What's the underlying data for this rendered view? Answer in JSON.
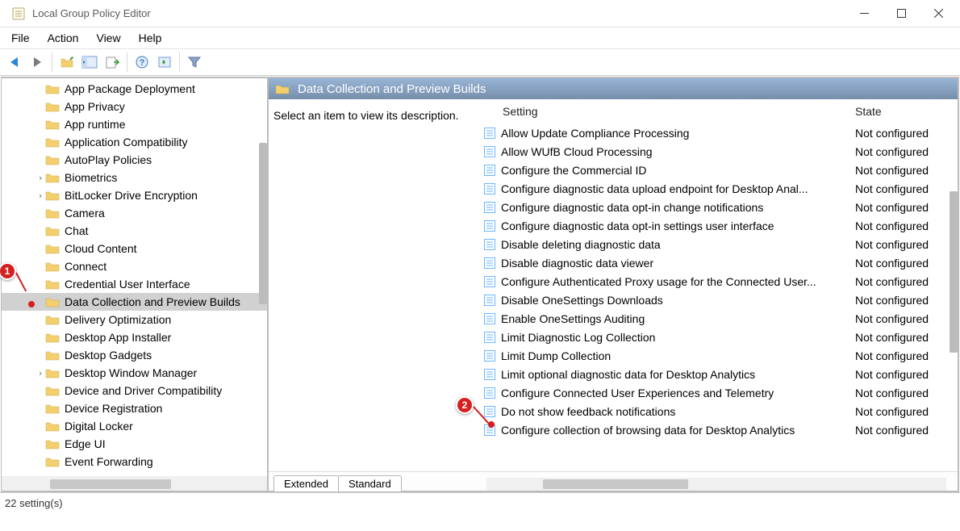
{
  "window": {
    "title": "Local Group Policy Editor"
  },
  "menubar": [
    "File",
    "Action",
    "View",
    "Help"
  ],
  "tree": {
    "items": [
      {
        "label": "App Package Deployment",
        "expandable": false,
        "indent": 1
      },
      {
        "label": "App Privacy",
        "expandable": false,
        "indent": 1
      },
      {
        "label": "App runtime",
        "expandable": false,
        "indent": 1
      },
      {
        "label": "Application Compatibility",
        "expandable": false,
        "indent": 1
      },
      {
        "label": "AutoPlay Policies",
        "expandable": false,
        "indent": 1
      },
      {
        "label": "Biometrics",
        "expandable": true,
        "indent": 1
      },
      {
        "label": "BitLocker Drive Encryption",
        "expandable": true,
        "indent": 1
      },
      {
        "label": "Camera",
        "expandable": false,
        "indent": 1
      },
      {
        "label": "Chat",
        "expandable": false,
        "indent": 1
      },
      {
        "label": "Cloud Content",
        "expandable": false,
        "indent": 1
      },
      {
        "label": "Connect",
        "expandable": false,
        "indent": 1
      },
      {
        "label": "Credential User Interface",
        "expandable": false,
        "indent": 1
      },
      {
        "label": "Data Collection and Preview Builds",
        "expandable": false,
        "indent": 1,
        "selected": true
      },
      {
        "label": "Delivery Optimization",
        "expandable": false,
        "indent": 1
      },
      {
        "label": "Desktop App Installer",
        "expandable": false,
        "indent": 1
      },
      {
        "label": "Desktop Gadgets",
        "expandable": false,
        "indent": 1
      },
      {
        "label": "Desktop Window Manager",
        "expandable": true,
        "indent": 1
      },
      {
        "label": "Device and Driver Compatibility",
        "expandable": false,
        "indent": 1
      },
      {
        "label": "Device Registration",
        "expandable": false,
        "indent": 1
      },
      {
        "label": "Digital Locker",
        "expandable": false,
        "indent": 1
      },
      {
        "label": "Edge UI",
        "expandable": false,
        "indent": 1
      },
      {
        "label": "Event Forwarding",
        "expandable": false,
        "indent": 1
      }
    ]
  },
  "right": {
    "header": "Data Collection and Preview Builds",
    "description": "Select an item to view its description.",
    "columns": {
      "setting": "Setting",
      "state": "State"
    },
    "settings": [
      {
        "name": "Allow Update Compliance Processing",
        "state": "Not configured"
      },
      {
        "name": "Allow WUfB Cloud Processing",
        "state": "Not configured"
      },
      {
        "name": "Configure the Commercial ID",
        "state": "Not configured"
      },
      {
        "name": "Configure diagnostic data upload endpoint for Desktop Anal...",
        "state": "Not configured"
      },
      {
        "name": "Configure diagnostic data opt-in change notifications",
        "state": "Not configured"
      },
      {
        "name": "Configure diagnostic data opt-in settings user interface",
        "state": "Not configured"
      },
      {
        "name": "Disable deleting diagnostic data",
        "state": "Not configured"
      },
      {
        "name": "Disable diagnostic data viewer",
        "state": "Not configured"
      },
      {
        "name": "Configure Authenticated Proxy usage for the Connected User...",
        "state": "Not configured"
      },
      {
        "name": "Disable OneSettings Downloads",
        "state": "Not configured"
      },
      {
        "name": "Enable OneSettings Auditing",
        "state": "Not configured"
      },
      {
        "name": "Limit Diagnostic Log Collection",
        "state": "Not configured"
      },
      {
        "name": "Limit Dump Collection",
        "state": "Not configured"
      },
      {
        "name": "Limit optional diagnostic data for Desktop Analytics",
        "state": "Not configured"
      },
      {
        "name": "Configure Connected User Experiences and Telemetry",
        "state": "Not configured"
      },
      {
        "name": "Do not show feedback notifications",
        "state": "Not configured"
      },
      {
        "name": "Configure collection of browsing data for Desktop Analytics",
        "state": "Not configured"
      }
    ],
    "tabs": [
      "Extended",
      "Standard"
    ]
  },
  "statusbar": "22 setting(s)",
  "annotations": {
    "a1": "1",
    "a2": "2"
  }
}
